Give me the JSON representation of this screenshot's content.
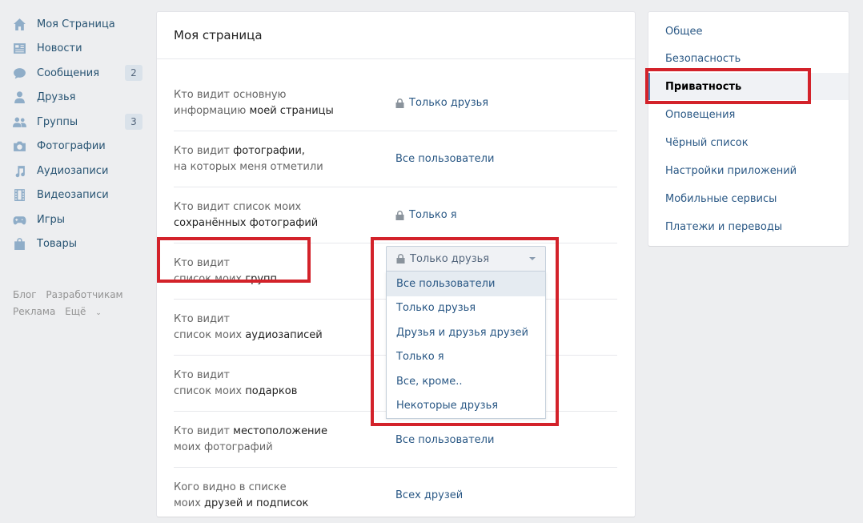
{
  "sidebar": {
    "items": [
      {
        "label": "Моя Страница",
        "icon": "home-icon"
      },
      {
        "label": "Новости",
        "icon": "news-icon"
      },
      {
        "label": "Сообщения",
        "icon": "messages-icon",
        "badge": "2"
      },
      {
        "label": "Друзья",
        "icon": "friends-icon"
      },
      {
        "label": "Группы",
        "icon": "groups-icon",
        "badge": "3"
      },
      {
        "label": "Фотографии",
        "icon": "camera-icon"
      },
      {
        "label": "Аудиозаписи",
        "icon": "music-icon"
      },
      {
        "label": "Видеозаписи",
        "icon": "film-icon"
      },
      {
        "label": "Игры",
        "icon": "gamepad-icon"
      },
      {
        "label": "Товары",
        "icon": "bag-icon"
      }
    ],
    "footer": {
      "blog": "Блог",
      "developers": "Разработчикам",
      "ads": "Реклама",
      "more": "Ещё"
    }
  },
  "main": {
    "title": "Моя страница",
    "rows": [
      {
        "label_plain": "Кто видит основную",
        "label_plain2": "информацию",
        "label_bold": "моей страницы",
        "value": "Только друзья",
        "lock": true
      },
      {
        "label_plain": "Кто видит",
        "label_bold": "фотографии,",
        "label_plain2": "на которых меня отметили",
        "value": "Все пользователи",
        "lock": false
      },
      {
        "label_plain": "Кто видит список моих",
        "label_bold": "сохранённых фотографий",
        "value": "Только я",
        "lock": true
      },
      {
        "label_plain": "Кто видит",
        "label_plain2": "список моих",
        "label_bold": "групп",
        "value": "Только друзья",
        "lock": true
      },
      {
        "label_plain": "Кто видит",
        "label_plain2": "список моих",
        "label_bold": "аудиозаписей",
        "value": "",
        "lock": false
      },
      {
        "label_plain": "Кто видит",
        "label_plain2": "список моих",
        "label_bold": "подарков",
        "value": "",
        "lock": false
      },
      {
        "label_plain": "Кто видит",
        "label_bold": "местоположение",
        "label_plain2": "моих фотографий",
        "value": "Все пользователи",
        "lock": false
      },
      {
        "label_plain": "Кого видно в списке",
        "label_plain2": "моих",
        "label_bold": "друзей и подписок",
        "value": "Всех друзей",
        "lock": false
      }
    ]
  },
  "dropdown": {
    "selected": "Только друзья",
    "options": [
      "Все пользователи",
      "Только друзья",
      "Друзья и друзья друзей",
      "Только я",
      "Все, кроме..",
      "Некоторые друзья"
    ],
    "hovered_index": 0
  },
  "settings_menu": {
    "items": [
      "Общее",
      "Безопасность",
      "Приватность",
      "Оповещения",
      "Чёрный список",
      "Настройки приложений",
      "Мобильные сервисы",
      "Платежи и переводы"
    ],
    "selected_index": 2
  },
  "colors": {
    "link": "#2a5885",
    "highlight": "#d3222a",
    "background": "#edeef0"
  }
}
